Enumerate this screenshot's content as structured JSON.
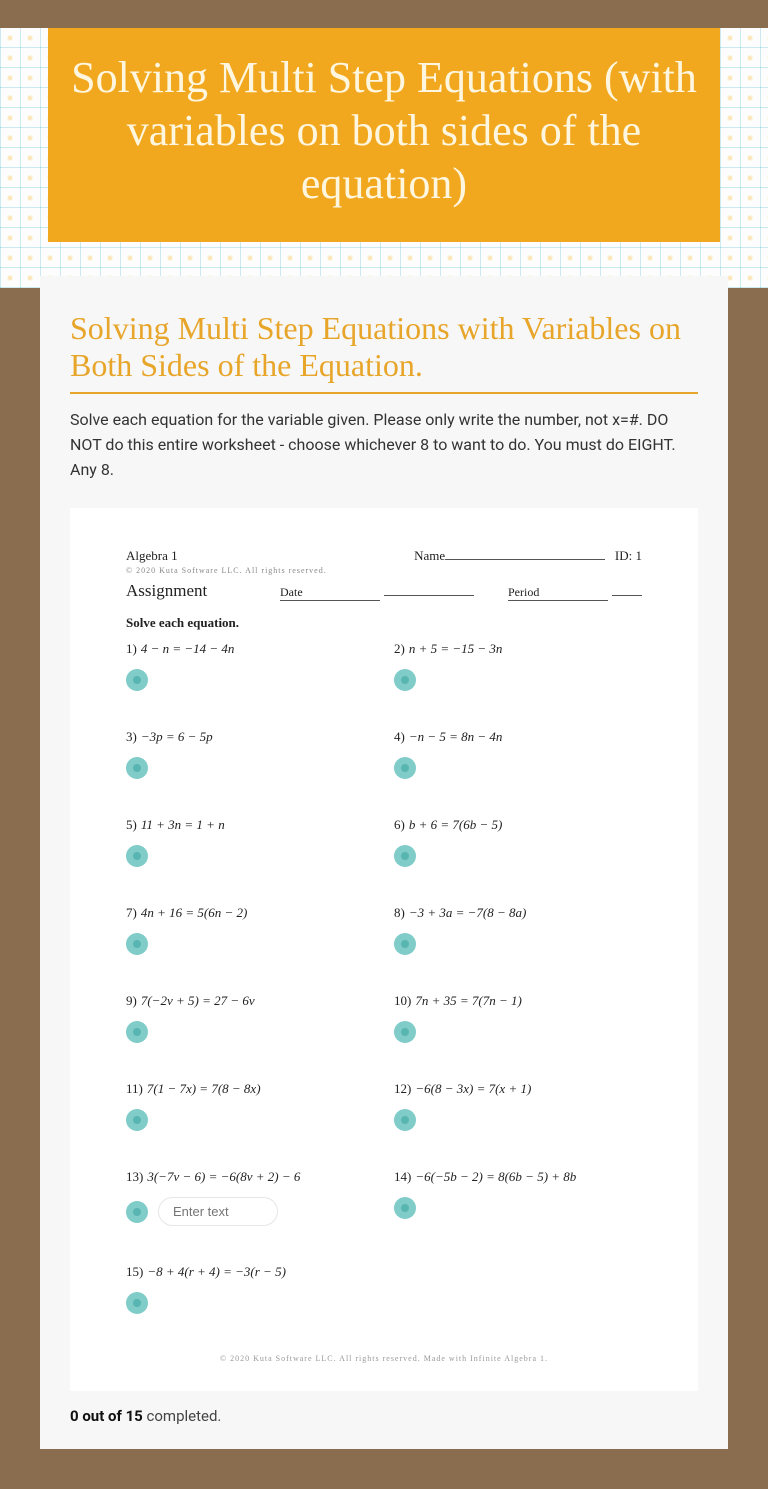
{
  "hero": {
    "title": "Solving Multi Step Equations (with variables on both sides of the equation)"
  },
  "section": {
    "title": "Solving Multi Step Equations with Variables on Both Sides of the Equation.",
    "instructions": "Solve each equation for the variable given.  Please only write the number, not x=#. DO NOT do this entire worksheet - choose whichever 8 to want to do. You must do EIGHT. Any 8."
  },
  "worksheet": {
    "course": "Algebra 1",
    "copyright_top": "© 2020  Kuta Software LLC.  All rights reserved.",
    "assignment": "Assignment",
    "name_label": "Name",
    "id_label": "ID: 1",
    "date_label": "Date",
    "period_label": "Period",
    "solve_label": "Solve each equation.",
    "problems": [
      {
        "n": "1)",
        "eq": "4 − n = −14 − 4n"
      },
      {
        "n": "2)",
        "eq": "n + 5 = −15 − 3n"
      },
      {
        "n": "3)",
        "eq": "−3p = 6 − 5p"
      },
      {
        "n": "4)",
        "eq": "−n − 5 = 8n − 4n"
      },
      {
        "n": "5)",
        "eq": "11 + 3n = 1 + n"
      },
      {
        "n": "6)",
        "eq": "b + 6 = 7(6b − 5)"
      },
      {
        "n": "7)",
        "eq": "4n + 16 = 5(6n − 2)"
      },
      {
        "n": "8)",
        "eq": "−3 + 3a = −7(8 − 8a)"
      },
      {
        "n": "9)",
        "eq": "7(−2v + 5) = 27 − 6v"
      },
      {
        "n": "10)",
        "eq": "7n + 35 = 7(7n − 1)"
      },
      {
        "n": "11)",
        "eq": "7(1 − 7x) = 7(8 − 8x)"
      },
      {
        "n": "12)",
        "eq": "−6(8 − 3x) = 7(x + 1)"
      },
      {
        "n": "13)",
        "eq": "3(−7v − 6) = −6(8v + 2) − 6"
      },
      {
        "n": "14)",
        "eq": "−6(−5b − 2) = 8(6b − 5) + 8b"
      },
      {
        "n": "15)",
        "eq": "−8 + 4(r + 4) = −3(r − 5)"
      }
    ],
    "input_placeholder": "Enter text",
    "copyright_bottom": "© 2020 Kuta Software LLC.  All rights reserved.  Made with Infinite Algebra 1."
  },
  "progress": {
    "done": "0 out of 15",
    "rest": " completed."
  }
}
